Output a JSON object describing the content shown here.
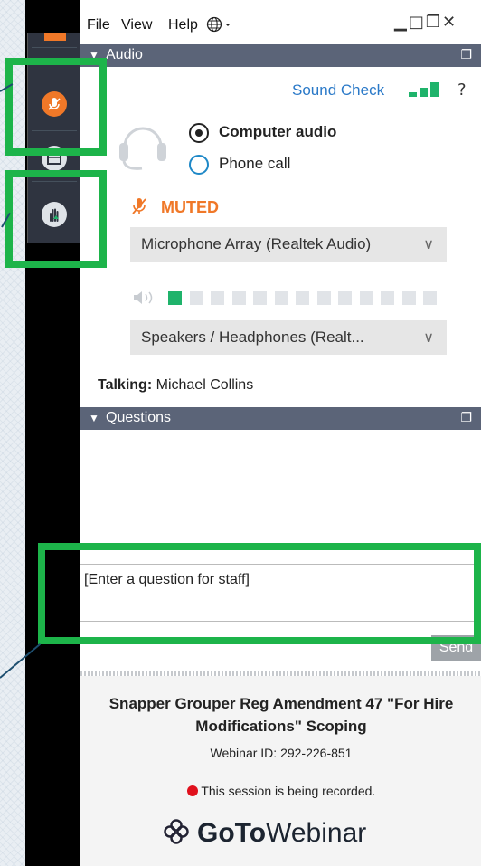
{
  "menu": {
    "file": "File",
    "view": "View",
    "help": "Help"
  },
  "audio": {
    "header": "Audio",
    "sound_check": "Sound Check",
    "help_mark": "?",
    "computer_audio": "Computer audio",
    "phone_call": "Phone call",
    "muted": "MUTED",
    "microphone": "Microphone Array (Realtek Audio)",
    "speakers": "Speakers / Headphones (Realt...",
    "talking_label": "Talking:",
    "talking_name": "Michael Collins",
    "mic_level_segments_lit": 1,
    "mic_level_segments_total": 13
  },
  "questions": {
    "header": "Questions",
    "placeholder": "[Enter a question for staff]",
    "send": "Send"
  },
  "webinar": {
    "title": "Snapper Grouper Reg Amendment 47 \"For Hire Modifications\" Scoping",
    "id_text": "Webinar ID: 292-226-851",
    "recording": "This session is being recorded.",
    "brand_goto": "GoTo",
    "brand_webinar": "Webinar"
  },
  "colors": {
    "header_bar": "#5b6478",
    "muted_orange": "#f07828",
    "highlight_green": "#1db44a",
    "signal_green": "#1fb36b",
    "link_blue": "#2a79c8",
    "record_red": "#e0101c"
  }
}
